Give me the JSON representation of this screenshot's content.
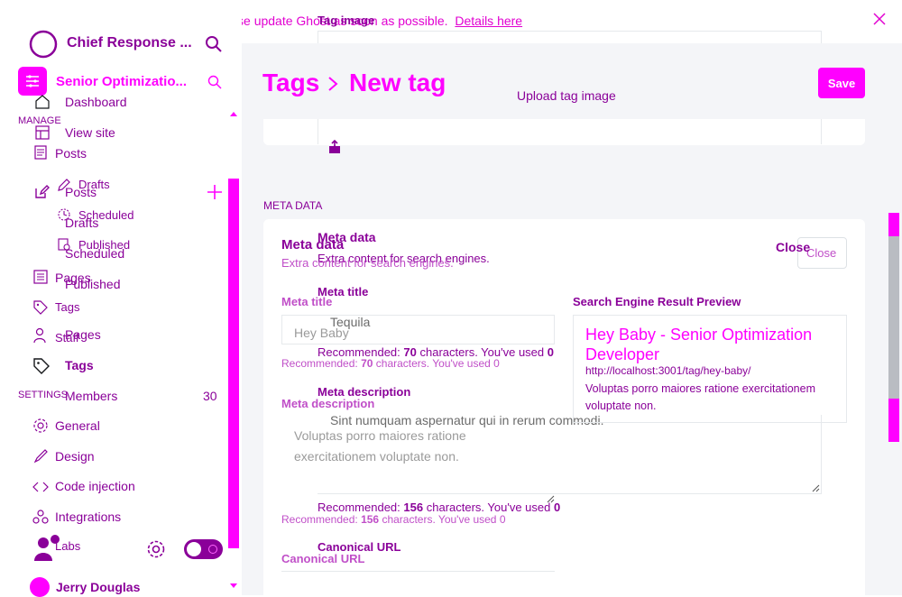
{
  "banner": {
    "text": "Critical security update available — please update Ghost as soon as possible.",
    "link": "Details here"
  },
  "sidebar": {
    "site_title": "Chief Response ...",
    "site_title_2": "Senior Optimizatio...",
    "manage_label": "MANAGE",
    "settings_label": "SETTINGS",
    "items": [
      {
        "label": "Dashboard"
      },
      {
        "label": "View site"
      },
      {
        "label": "Posts"
      },
      {
        "label": "Drafts"
      },
      {
        "label": "Posts"
      },
      {
        "label": "Scheduled"
      },
      {
        "label": "Drafts"
      },
      {
        "label": "Published"
      },
      {
        "label": "Scheduled"
      },
      {
        "label": "Pages"
      },
      {
        "label": "Published"
      },
      {
        "label": "Tags"
      },
      {
        "label": "Staff"
      },
      {
        "label": "Pages"
      },
      {
        "label": "Tags"
      },
      {
        "label": "Members"
      },
      {
        "label": "General"
      },
      {
        "label": "Design"
      },
      {
        "label": "Code injection"
      },
      {
        "label": "Integrations"
      },
      {
        "label": "Labs"
      }
    ],
    "members_count": "30",
    "user_name": "Jerry Douglas"
  },
  "header": {
    "crumb_root": "Tags",
    "crumb_sep": ">",
    "crumb_current": "New tag",
    "save_label": "Save",
    "tag_image_label": "Tag image",
    "upload_label": "Upload tag image"
  },
  "meta": {
    "section_label": "META DATA",
    "title": "Meta data",
    "subtitle": "Extra content for search engines.",
    "close_label": "Close",
    "meta_title_label": "Meta title",
    "meta_title_value": "Tequila",
    "meta_title_value_shadow": "Hey Baby",
    "meta_title_hint_pre": "Recommended:",
    "meta_title_hint_num": "70",
    "meta_title_hint_mid": "characters. You've used",
    "meta_title_hint_used": "0",
    "meta_desc_label": "Meta description",
    "meta_desc_value": "Sint numquam aspernatur qui in rerum commodi.",
    "meta_desc_value_shadow": "Voluptas porro maiores ratione exercitationem voluptate non.",
    "meta_desc_hint_pre": "Recommended:",
    "meta_desc_hint_num": "156",
    "meta_desc_hint_mid": "characters. You've used",
    "meta_desc_hint_used": "0",
    "canonical_label": "Canonical URL",
    "serp_label": "Search Engine Result Preview",
    "serp_title": "Hey Baby - Senior Optimization Developer",
    "serp_url": "http://localhost:3001/tag/hey-baby/",
    "serp_desc": "Voluptas porro maiores ratione exercitationem voluptate non."
  },
  "colors": {
    "accent": "#ff00ff",
    "accent_dark": "#8a0099",
    "banner_text": "#e100d1"
  }
}
